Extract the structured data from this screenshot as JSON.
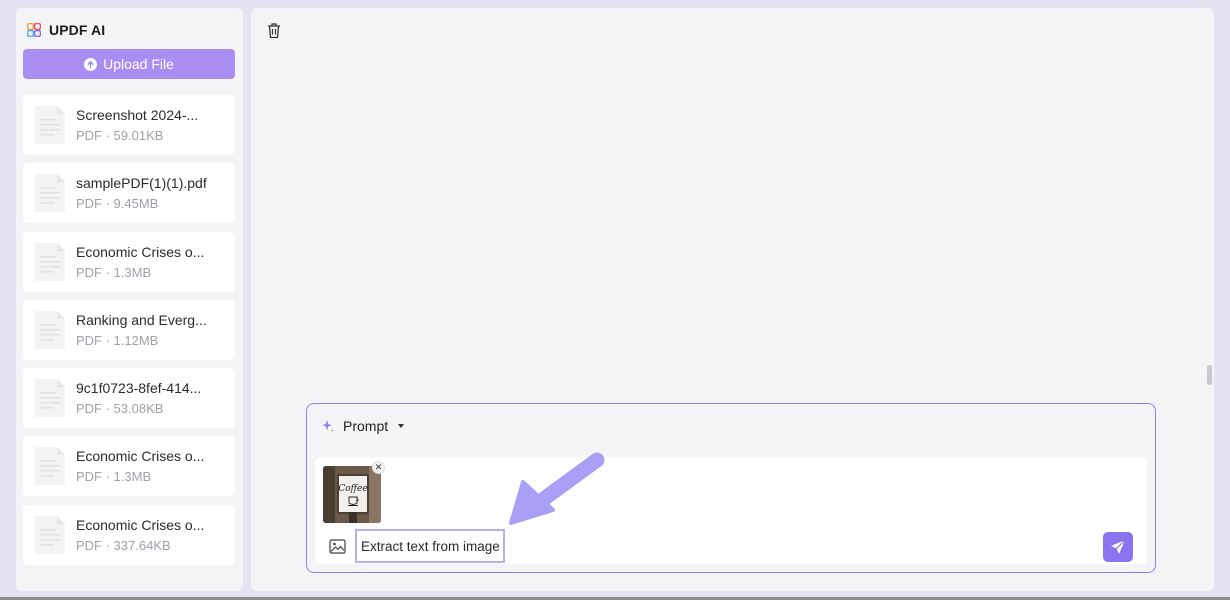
{
  "app": {
    "title": "UPDF AI",
    "upload_label": "Upload File"
  },
  "files": [
    {
      "name": "Screenshot 2024-...",
      "meta": "PDF · 59.01KB"
    },
    {
      "name": "samplePDF(1)(1).pdf",
      "meta": "PDF · 9.45MB"
    },
    {
      "name": "Economic Crises o...",
      "meta": "PDF · 1.3MB"
    },
    {
      "name": "Ranking and Everg...",
      "meta": "PDF · 1.12MB"
    },
    {
      "name": "9c1f0723-8fef-414...",
      "meta": "PDF · 53.08KB"
    },
    {
      "name": "Economic Crises o...",
      "meta": "PDF · 1.3MB"
    },
    {
      "name": "Economic Crises o...",
      "meta": "PDF · 337.64KB"
    }
  ],
  "prompt": {
    "mode_label": "Prompt",
    "input_value": "Extract text from image",
    "attachment_text": "Coffee"
  },
  "colors": {
    "accent": "#8b72ee",
    "upload_button": "#a98df2",
    "panel": "#f4f4f7",
    "background": "#e3e3f2",
    "arrow": "#a99ff5"
  },
  "icons": {
    "logo": "updf-logo-icon",
    "upload": "upload-icon",
    "file": "file-icon",
    "trash": "trash-icon",
    "sparkle": "sparkle-icon",
    "caret": "caret-down-icon",
    "image": "image-icon",
    "send": "send-icon",
    "close": "close-icon"
  }
}
